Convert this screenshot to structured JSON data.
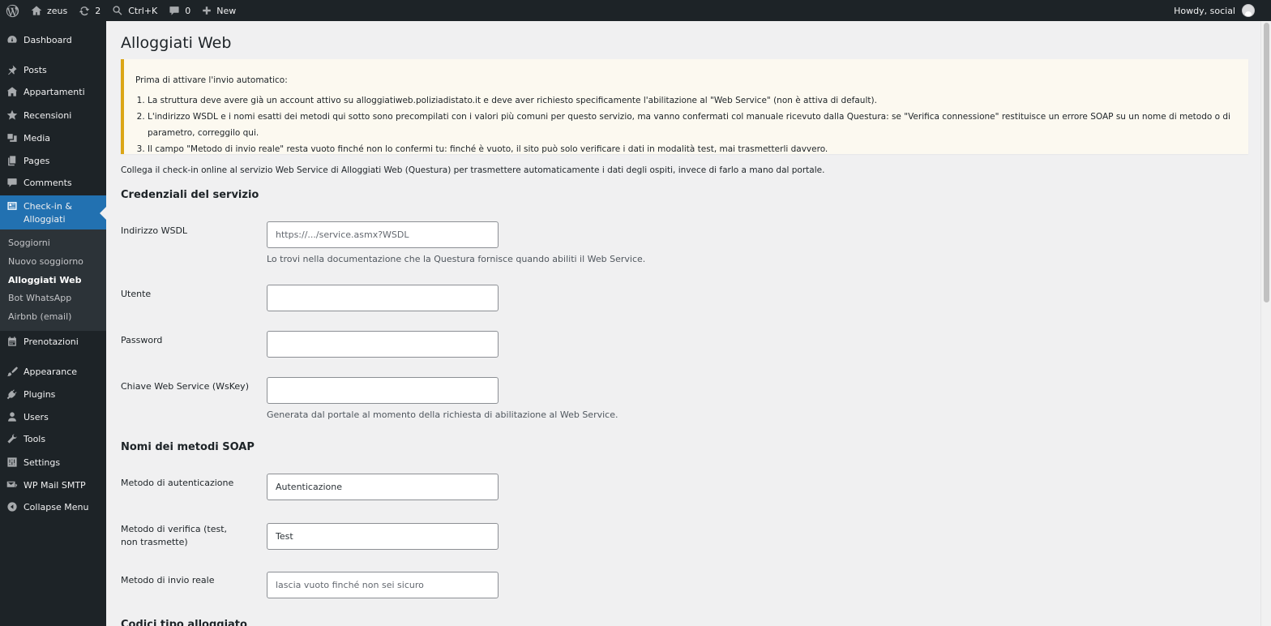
{
  "adminbar": {
    "site_name": "zeus",
    "updates_count": "2",
    "search_shortcut": "Ctrl+K",
    "comments_count": "0",
    "new_label": "New",
    "howdy": "Howdy, social"
  },
  "sidebar": {
    "items": {
      "dashboard": "Dashboard",
      "posts": "Posts",
      "appartamenti": "Appartamenti",
      "recensioni": "Recensioni",
      "media": "Media",
      "pages": "Pages",
      "comments": "Comments",
      "checkin": "Check-in & Alloggiati",
      "prenotazioni": "Prenotazioni",
      "appearance": "Appearance",
      "plugins": "Plugins",
      "users": "Users",
      "tools": "Tools",
      "settings": "Settings",
      "wpmail": "WP Mail SMTP",
      "collapse": "Collapse Menu"
    },
    "submenu": {
      "soggiorni": "Soggiorni",
      "nuovo": "Nuovo soggiorno",
      "alloggiati": "Alloggiati Web",
      "whatsapp": "Bot WhatsApp",
      "airbnb": "Airbnb (email)"
    }
  },
  "page": {
    "title": "Alloggiati Web",
    "notice": {
      "heading": "Prima di attivare l'invio automatico:",
      "items": [
        "La struttura deve avere già un account attivo su alloggiatiweb.poliziadistato.it e deve aver richiesto specificamente l'abilitazione al \"Web Service\" (non è attiva di default).",
        "L'indirizzo WSDL e i nomi esatti dei metodi qui sotto sono precompilati con i valori più comuni per questo servizio, ma vanno confermati col manuale ricevuto dalla Questura: se \"Verifica connessione\" restituisce un errore SOAP su un nome di metodo o di parametro, correggilo qui.",
        "Il campo \"Metodo di invio reale\" resta vuoto finché non lo confermi tu: finché è vuoto, il sito può solo verificare i dati in modalità test, mai trasmetterli davvero."
      ]
    },
    "intro": "Collega il check-in online al servizio Web Service di Alloggiati Web (Questura) per trasmettere automaticamente i dati degli ospiti, invece di farlo a mano dal portale.",
    "sections": {
      "credentials": "Credenziali del servizio",
      "methods": "Nomi dei metodi SOAP",
      "codes": "Codici tipo alloggiato"
    },
    "fields": {
      "wsdl": {
        "label": "Indirizzo WSDL",
        "value": "",
        "placeholder": "https://.../service.asmx?WSDL",
        "desc": "Lo trovi nella documentazione che la Questura fornisce quando abiliti il Web Service."
      },
      "user": {
        "label": "Utente",
        "value": ""
      },
      "password": {
        "label": "Password",
        "value": ""
      },
      "wskey": {
        "label": "Chiave Web Service (WsKey)",
        "value": "",
        "desc": "Generata dal portale al momento della richiesta di abilitazione al Web Service."
      },
      "auth_method": {
        "label": "Metodo di autenticazione",
        "value": "Autenticazione"
      },
      "test_method": {
        "label": "Metodo di verifica (test, non trasmette)",
        "value": "Test"
      },
      "send_method": {
        "label": "Metodo di invio reale",
        "value": "",
        "placeholder": "lascia vuoto finché non sei sicuro"
      }
    }
  }
}
